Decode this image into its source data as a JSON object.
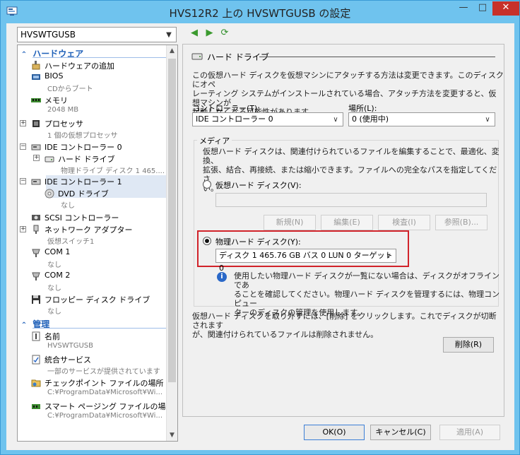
{
  "window": {
    "title": "HVS12R2 上の HVSWTGUSB の設定",
    "min_glyph": "—",
    "max_glyph": "□",
    "close_glyph": "✕"
  },
  "vm_selector": {
    "value": "HVSWTGUSB"
  },
  "tree": {
    "hardware_section": "ハードウェア",
    "management_section": "管理",
    "items": [
      {
        "label": "ハードウェアの追加",
        "sub": ""
      },
      {
        "label": "BIOS",
        "sub": "CDからブート"
      },
      {
        "label": "メモリ",
        "sub": "2048 MB"
      },
      {
        "label": "プロセッサ",
        "sub": "1 個の仮想プロセッサ"
      },
      {
        "label": "IDE コントローラー 0",
        "sub": ""
      },
      {
        "label": "ハード ドライブ",
        "sub": "物理ドライブ ディスク 1 465...."
      },
      {
        "label": "IDE コントローラー 1",
        "sub": ""
      },
      {
        "label": "DVD ドライブ",
        "sub": "なし"
      },
      {
        "label": "SCSI コントローラー",
        "sub": ""
      },
      {
        "label": "ネットワーク アダプター",
        "sub": "仮想スイッチ1"
      },
      {
        "label": "COM 1",
        "sub": "なし"
      },
      {
        "label": "COM 2",
        "sub": "なし"
      },
      {
        "label": "フロッピー ディスク ドライブ",
        "sub": "なし"
      }
    ],
    "mgmt_items": [
      {
        "label": "名前",
        "sub": "HVSWTGUSB"
      },
      {
        "label": "統合サービス",
        "sub": "一部のサービスが提供されています"
      },
      {
        "label": "チェックポイント ファイルの場所",
        "sub": "C:¥ProgramData¥Microsoft¥Wi..."
      },
      {
        "label": "スマート ページング ファイルの場所",
        "sub": "C:¥ProgramData¥Microsoft¥Wi..."
      }
    ]
  },
  "panel": {
    "heading": "ハード ドライブ",
    "intro_lines": [
      "この仮想ハード ディスクを仮想マシンにアタッチする方法は変更できます。このディスクにオペ",
      "レーティング システムがインストールされている場合、アタッチ方法を変更すると、仮想マシンが",
      "起動しなくなる可能性があります。"
    ],
    "controller_label": "コントローラー(T):",
    "controller_value": "IDE コントローラー 0",
    "location_label": "場所(L):",
    "location_value": "0 (使用中)",
    "media_title": "メディア",
    "media_lines": [
      "仮想ハード ディスクは、関連付けられているファイルを編集することで、最適化、変換、",
      "拡張、結合、再接続、または縮小できます。ファイルへの完全なパスを指定してくださ",
      "い。"
    ],
    "virtual_disk_label": "仮想ハード ディスク(V):",
    "btn_new": "新規(N)",
    "btn_edit": "編集(E)",
    "btn_inspect": "検査(I)",
    "btn_browse": "参照(B)...",
    "physical_disk_label": "物理ハード ディスク(Y):",
    "physical_disk_value": "ディスク 1 465.76 GB バス 0 LUN 0 ターゲット 0",
    "info_lines": [
      "使用したい物理ハード ディスクが一覧にない場合は、ディスクがオフラインであ",
      "ることを確認してください。物理ハード ディスクを管理するには、物理コンピュー",
      "ターのディスクの管理を使用します。"
    ],
    "remove_lines": [
      "仮想ハード ディスクを取り外すには、[削除] をクリックします。これでディスクが切断されます",
      "が、関連付けられているファイルは削除されません。"
    ],
    "btn_remove": "削除(R)"
  },
  "footer": {
    "ok": "OK(O)",
    "cancel": "キャンセル(C)",
    "apply": "適用(A)"
  },
  "colors": {
    "title_bar": "#6fc3ee",
    "section_blue": "#1d5fb8",
    "highlight_red": "#d1232a",
    "close_red": "#c7312a"
  }
}
